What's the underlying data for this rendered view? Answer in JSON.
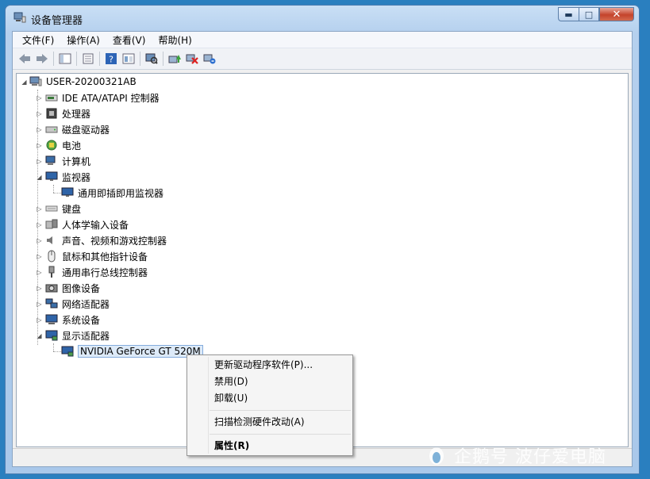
{
  "window": {
    "title": "设备管理器",
    "colors": {
      "titlebar": "#b5d0ee",
      "close": "#c4432b"
    }
  },
  "caption": {
    "minimize": "▬",
    "maximize": "□",
    "close": "✕"
  },
  "menu": [
    "文件(F)",
    "操作(A)",
    "查看(V)",
    "帮助(H)"
  ],
  "toolbar_icons": [
    "back-arrow-icon",
    "forward-arrow-icon",
    "show-hide-tree-icon",
    "properties-icon",
    "help-icon",
    "console-view-icon",
    "scan-hardware-icon",
    "update-driver-icon",
    "disable-device-icon",
    "uninstall-device-icon"
  ],
  "tree": {
    "root": "USER-20200321AB",
    "categories": [
      {
        "label": "IDE ATA/ATAPI 控制器",
        "icon": "ide-controller-icon"
      },
      {
        "label": "处理器",
        "icon": "processor-icon"
      },
      {
        "label": "磁盘驱动器",
        "icon": "disk-drive-icon"
      },
      {
        "label": "电池",
        "icon": "battery-icon"
      },
      {
        "label": "计算机",
        "icon": "computer-icon"
      },
      {
        "label": "监视器",
        "icon": "monitor-icon",
        "expanded": true,
        "children": [
          "通用即插即用监视器"
        ]
      },
      {
        "label": "键盘",
        "icon": "keyboard-icon"
      },
      {
        "label": "人体学输入设备",
        "icon": "hid-icon"
      },
      {
        "label": "声音、视频和游戏控制器",
        "icon": "sound-icon"
      },
      {
        "label": "鼠标和其他指针设备",
        "icon": "mouse-icon"
      },
      {
        "label": "通用串行总线控制器",
        "icon": "usb-icon"
      },
      {
        "label": "图像设备",
        "icon": "imaging-icon"
      },
      {
        "label": "网络适配器",
        "icon": "network-icon"
      },
      {
        "label": "系统设备",
        "icon": "system-icon"
      },
      {
        "label": "显示适配器",
        "icon": "display-adapter-icon",
        "expanded": true,
        "children": [
          "NVIDIA GeForce GT 520M"
        ]
      }
    ]
  },
  "context_menu": {
    "items": [
      "更新驱动程序软件(P)...",
      "禁用(D)",
      "卸载(U)",
      "扫描检测硬件改动(A)",
      "属性(R)"
    ]
  },
  "watermark": "企鹅号 波仔爱电脑"
}
